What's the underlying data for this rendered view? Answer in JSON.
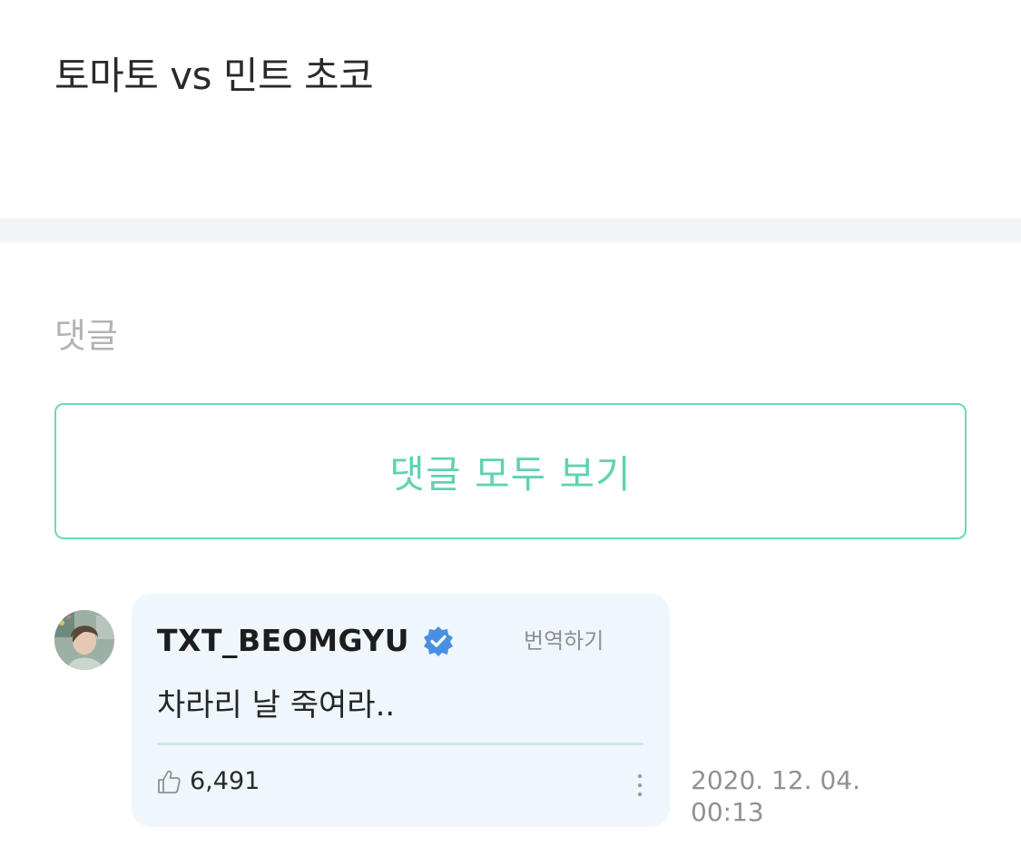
{
  "post": {
    "title": "토마토 vs 민트 초코"
  },
  "comments_section": {
    "label": "댓글",
    "view_all_label": "댓글 모두 보기"
  },
  "comment": {
    "author": "TXT_BEOMGYU",
    "verified": true,
    "translate_label": "번역하기",
    "text": "차라리 날 죽여라..",
    "likes": "6,491",
    "date": "2020. 12. 04.",
    "time": "00:13"
  },
  "icons": {
    "verified": "verified-badge-icon",
    "like": "thumbs-up-icon",
    "more": "vertical-ellipsis-icon"
  },
  "colors": {
    "accent": "#5fd3b1",
    "verified_badge": "#4a90e2",
    "card_background": "#eff6fc",
    "divider_band": "#f3f4f6"
  }
}
